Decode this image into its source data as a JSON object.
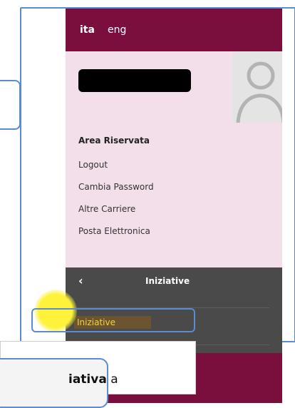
{
  "languages": [
    {
      "label": "ita",
      "active": true
    },
    {
      "label": "eng",
      "active": false
    }
  ],
  "user": {
    "section_title": "Area Riservata",
    "menu": [
      "Logout",
      "Cambia Password",
      "Altre Carriere",
      "Posta Elettronica"
    ]
  },
  "submenu": {
    "title": "Iniziative",
    "items": [
      "Iniziative"
    ]
  },
  "tooltip": {
    "bold": "iativa",
    "rest": " a"
  },
  "colors": {
    "brand": "#7a0f3d",
    "user_bg": "#f3dfe9",
    "dark_nav": "#4a4a4a",
    "highlight_text": "#f1d43a",
    "annotation_blue": "#5b8bd1"
  }
}
